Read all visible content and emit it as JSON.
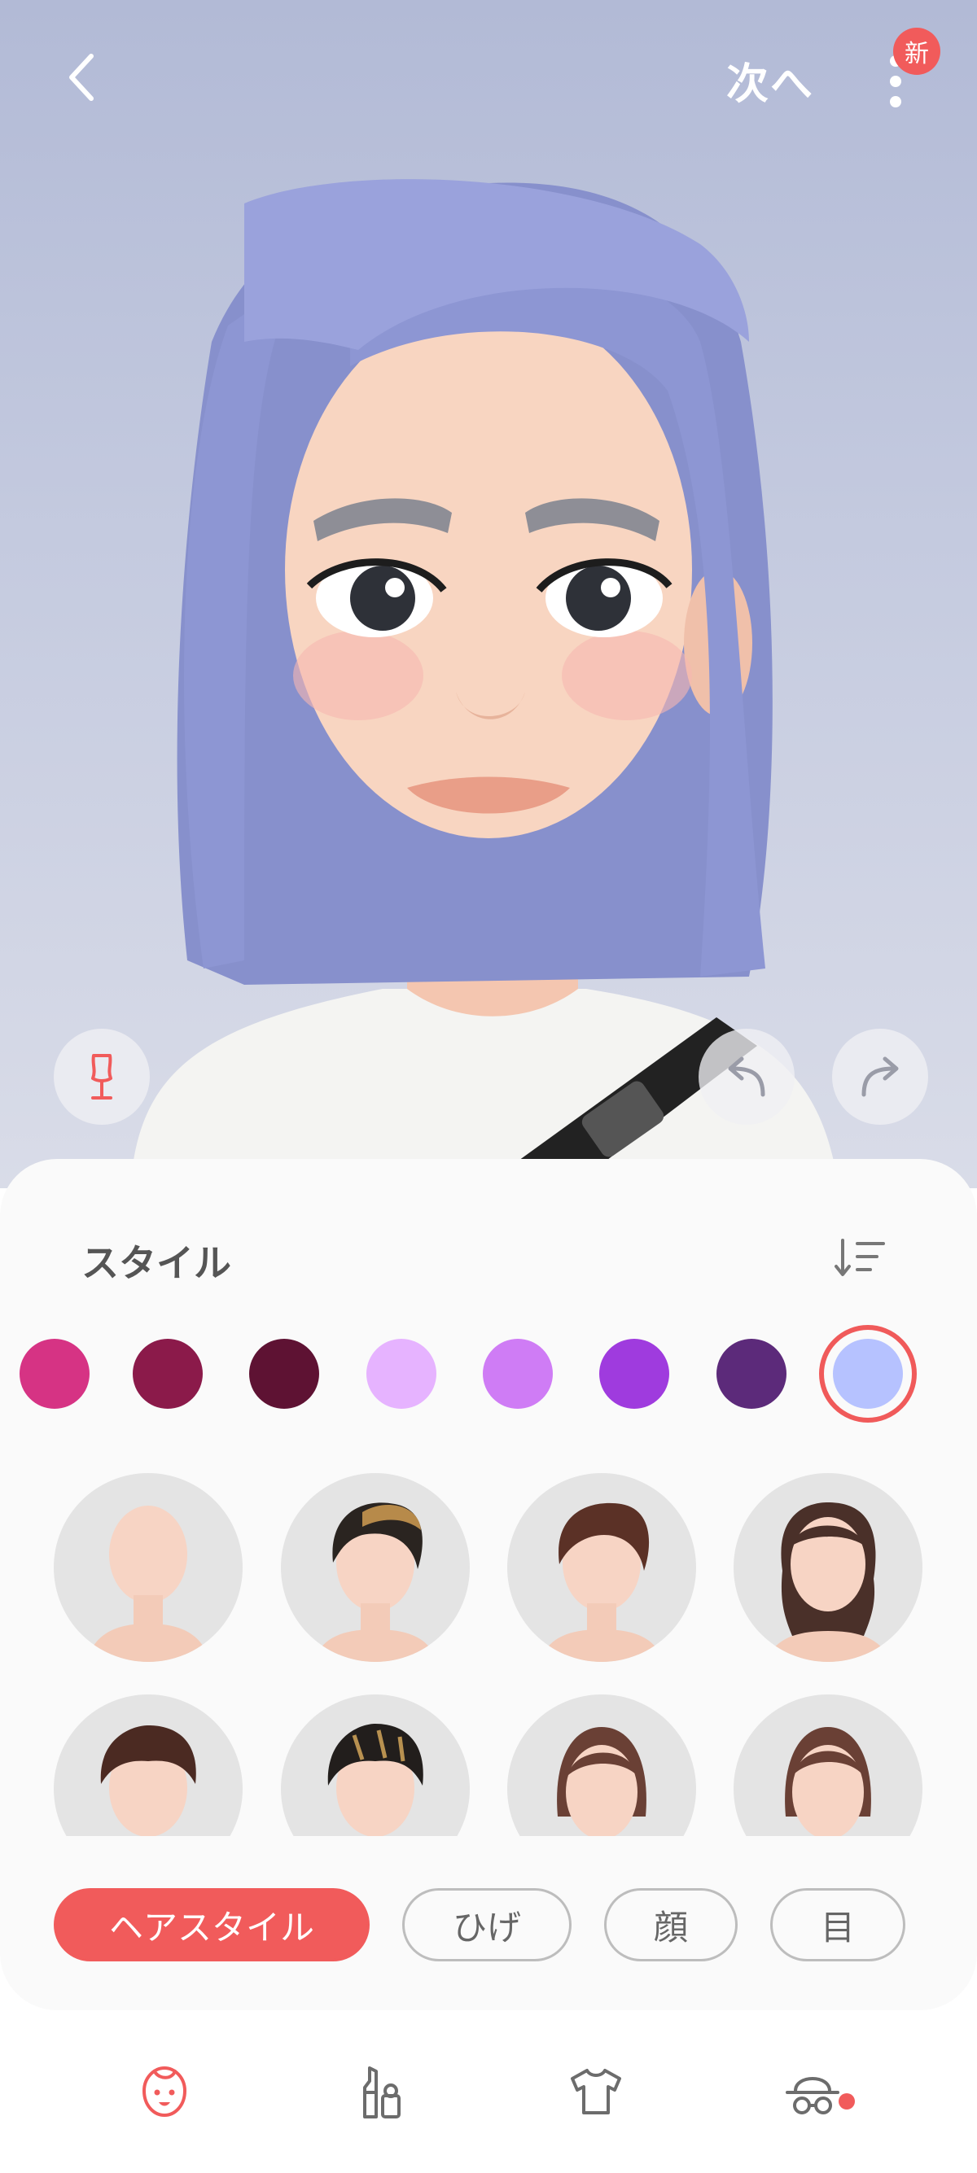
{
  "topbar": {
    "next_label": "次へ",
    "new_badge": "新"
  },
  "panel": {
    "title": "スタイル"
  },
  "colors": {
    "accent": "#f15b5b",
    "hair": "#8e98d4",
    "swatches": [
      "#d63384",
      "#8b1a4a",
      "#5e1233",
      "#e6b3ff",
      "#cf7cf5",
      "#9f3bde",
      "#5c2a7a",
      "#b6c2ff"
    ],
    "selected_swatch_index": 7
  },
  "hair_styles": [
    {
      "id": "bald"
    },
    {
      "id": "two-tone-swept"
    },
    {
      "id": "brown-swept"
    },
    {
      "id": "curly-bangs"
    },
    {
      "id": "short-brown"
    },
    {
      "id": "short-highlights"
    },
    {
      "id": "parted-bun"
    },
    {
      "id": "slick-bun"
    }
  ],
  "categories": {
    "hairstyle": "ヘアスタイル",
    "beard": "ひげ",
    "face": "顔",
    "eyes": "目"
  },
  "nav": {
    "items": [
      "face-icon",
      "makeup-icon",
      "clothing-icon",
      "accessory-icon"
    ],
    "active_index": 0
  }
}
